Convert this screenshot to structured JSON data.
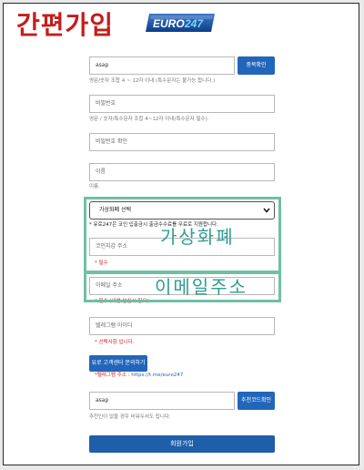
{
  "header": {
    "title": "간편가입",
    "logo_text": "EURO",
    "logo_number": "247"
  },
  "form": {
    "user_id": {
      "value": "asap",
      "check_button": "중복확인",
      "help": "영문/숫자 조합 4 ~ 12자 이내 (특수문자는 불가능 합니다.)"
    },
    "password": {
      "placeholder": "비밀번호",
      "help": "영문 / 숫자/특수문자 조합 4~12자 이내(특수문자 필수)."
    },
    "password_confirm": {
      "placeholder": "비밀번호 확인"
    },
    "name": {
      "placeholder": "이름",
      "help": "이름."
    },
    "currency": {
      "selected": "가상화폐 선택",
      "notice": "* 유로247은 코인 입출금시 출금수수료를 무료로 지원합니다."
    },
    "wallet": {
      "placeholder": "코인지갑 주소",
      "required": "* 필수"
    },
    "email": {
      "placeholder": "이메일 주소",
      "required": "* 필수 (비번 분실시 필요)."
    },
    "telegram": {
      "placeholder": "텔레그램 아이디",
      "required": "* 선택사항 입니다."
    },
    "support_button": "유로 고객센터 문의하기",
    "telegram_link": {
      "label": "*텔레그램 주소 : ",
      "url": "https://t.me/euro247"
    },
    "referral": {
      "value": "asap",
      "button": "추천코드확인",
      "help": "추천인이 없을 경우 비워두셔도 됩니다."
    },
    "submit": "회원가입"
  },
  "annotations": {
    "currency_label": "가상화폐",
    "email_label": "이메일주소",
    "color": "#6fbfa6"
  }
}
